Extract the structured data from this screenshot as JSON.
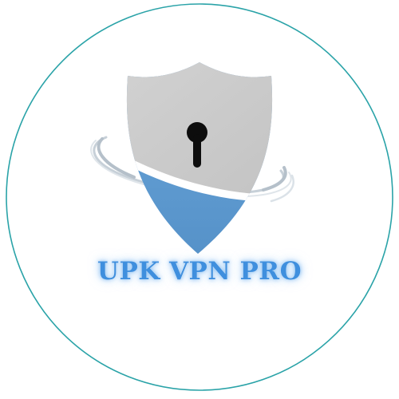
{
  "logo": {
    "title": "UPK VPN PRO",
    "icons": [
      "shield-icon",
      "keyhole-icon",
      "orbit-ring-icon"
    ],
    "colors": {
      "ring": "#2aa3a8",
      "shield_top": "#c9c9c9",
      "shield_bottom": "#5d9ad0",
      "keyhole": "#0d0d0d",
      "swoosh": "#b9c4cf",
      "title": "#3f8fde",
      "title_glow": "#a9cdf3"
    }
  }
}
